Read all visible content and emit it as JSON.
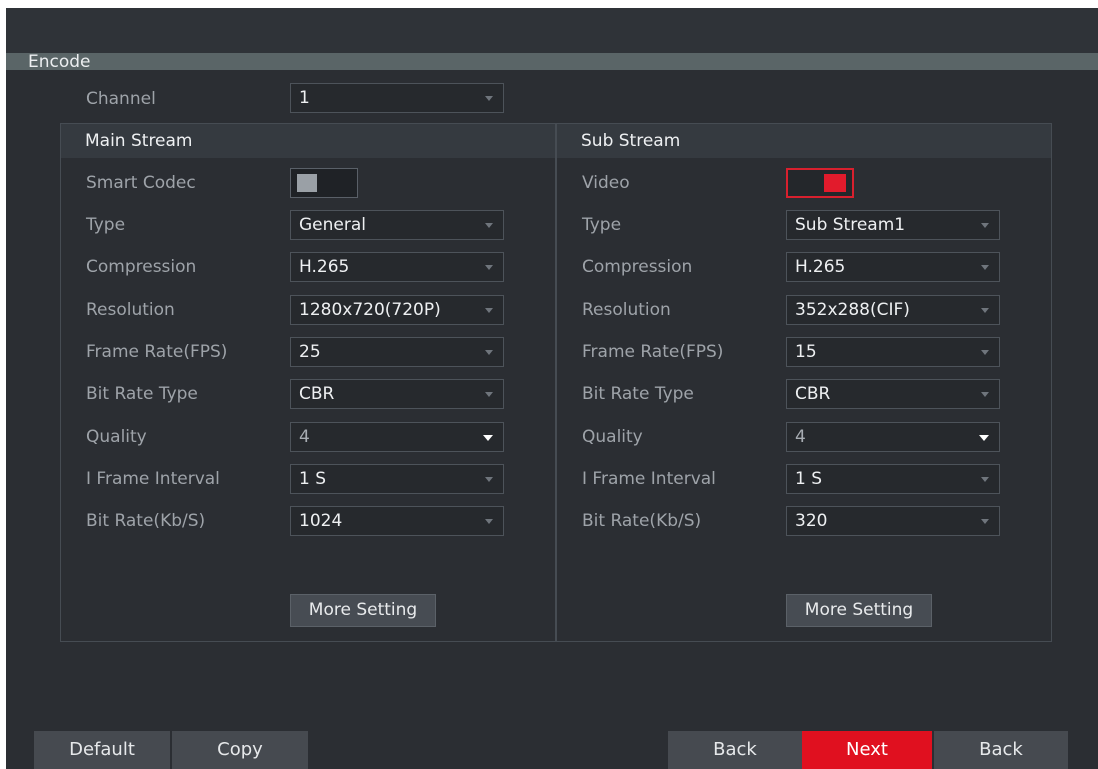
{
  "section_title": "Encode",
  "channel": {
    "label": "Channel",
    "value": "1"
  },
  "main": {
    "title": "Main Stream",
    "smart_codec": {
      "label": "Smart Codec",
      "state": "off"
    },
    "fields": [
      {
        "label": "Type",
        "value": "General"
      },
      {
        "label": "Compression",
        "value": "H.265"
      },
      {
        "label": "Resolution",
        "value": "1280x720(720P)"
      },
      {
        "label": "Frame Rate(FPS)",
        "value": "25"
      },
      {
        "label": "Bit Rate Type",
        "value": "CBR"
      },
      {
        "label": "Quality",
        "value": "4"
      },
      {
        "label": "I Frame Interval",
        "value": "1 S"
      },
      {
        "label": "Bit Rate(Kb/S)",
        "value": "1024"
      }
    ],
    "more_label": "More Setting"
  },
  "sub": {
    "title": "Sub Stream",
    "video": {
      "label": "Video",
      "state": "on"
    },
    "fields": [
      {
        "label": "Type",
        "value": "Sub Stream1"
      },
      {
        "label": "Compression",
        "value": "H.265"
      },
      {
        "label": "Resolution",
        "value": "352x288(CIF)"
      },
      {
        "label": "Frame Rate(FPS)",
        "value": "15"
      },
      {
        "label": "Bit Rate Type",
        "value": "CBR"
      },
      {
        "label": "Quality",
        "value": "4"
      },
      {
        "label": "I Frame Interval",
        "value": "1 S"
      },
      {
        "label": "Bit Rate(Kb/S)",
        "value": "320"
      }
    ],
    "more_label": "More Setting"
  },
  "footer": {
    "default": "Default",
    "copy": "Copy",
    "back": "Back",
    "next": "Next",
    "back2": "Back"
  },
  "colors": {
    "accent": "#e0101f",
    "background": "#2b2e33"
  },
  "icons": {
    "dropdown": "chevron-down-icon"
  }
}
